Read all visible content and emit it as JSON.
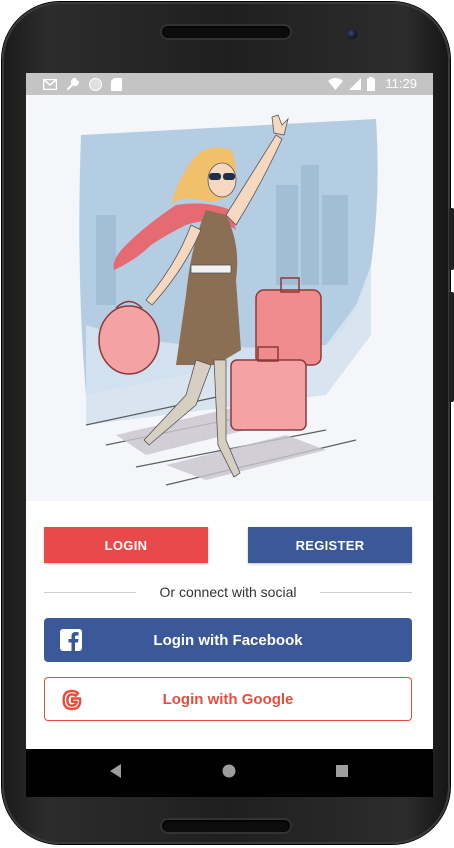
{
  "status_bar": {
    "time": "11:29",
    "left_icons": [
      "gmail-icon",
      "wrench-icon",
      "circle-icon",
      "sd-card-icon"
    ],
    "right_icons": [
      "wifi-icon",
      "signal-icon",
      "battery-icon"
    ]
  },
  "auth": {
    "login_label": "LOGIN",
    "register_label": "REGISTER"
  },
  "social": {
    "divider_text": "Or connect with social",
    "facebook_label": "Login with Facebook",
    "google_label": "Login with Google"
  },
  "nav": {
    "icons": [
      "back-icon",
      "home-icon",
      "recents-icon"
    ]
  },
  "colors": {
    "login": "#e8494a",
    "register": "#3b5998",
    "facebook": "#3b5998",
    "google": "#e84c3d"
  }
}
